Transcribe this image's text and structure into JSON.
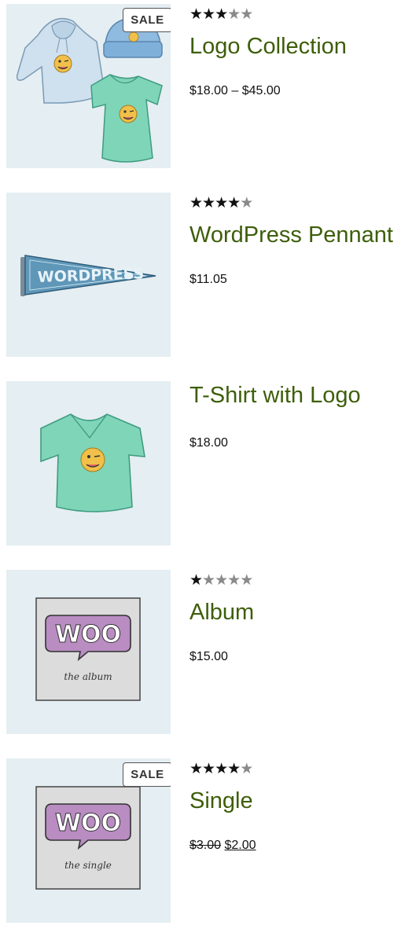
{
  "products": [
    {
      "title": "Logo Collection",
      "sale_badge": "SALE",
      "rating": 3,
      "price_min": "$18.00",
      "price_sep": "–",
      "price_max": "$45.00"
    },
    {
      "title": "WordPress Pennant",
      "rating": 4,
      "price": "$11.05",
      "image_text": "WORDPRESS"
    },
    {
      "title": "T-Shirt with Logo",
      "price": "$18.00"
    },
    {
      "title": "Album",
      "rating": 1,
      "price": "$15.00",
      "image_text": "WOO",
      "image_subtext": "the album"
    },
    {
      "title": "Single",
      "sale_badge": "SALE",
      "rating": 4,
      "price_regular": "$3.00",
      "price_sale": "$2.00",
      "image_text": "WOO",
      "image_subtext": "the single"
    }
  ],
  "rating_max": 5,
  "colors": {
    "title": "#3e5e0a",
    "thumb_bg": "#e5eef2",
    "star_filled": "#111111",
    "star_empty": "#8a8a8a"
  }
}
